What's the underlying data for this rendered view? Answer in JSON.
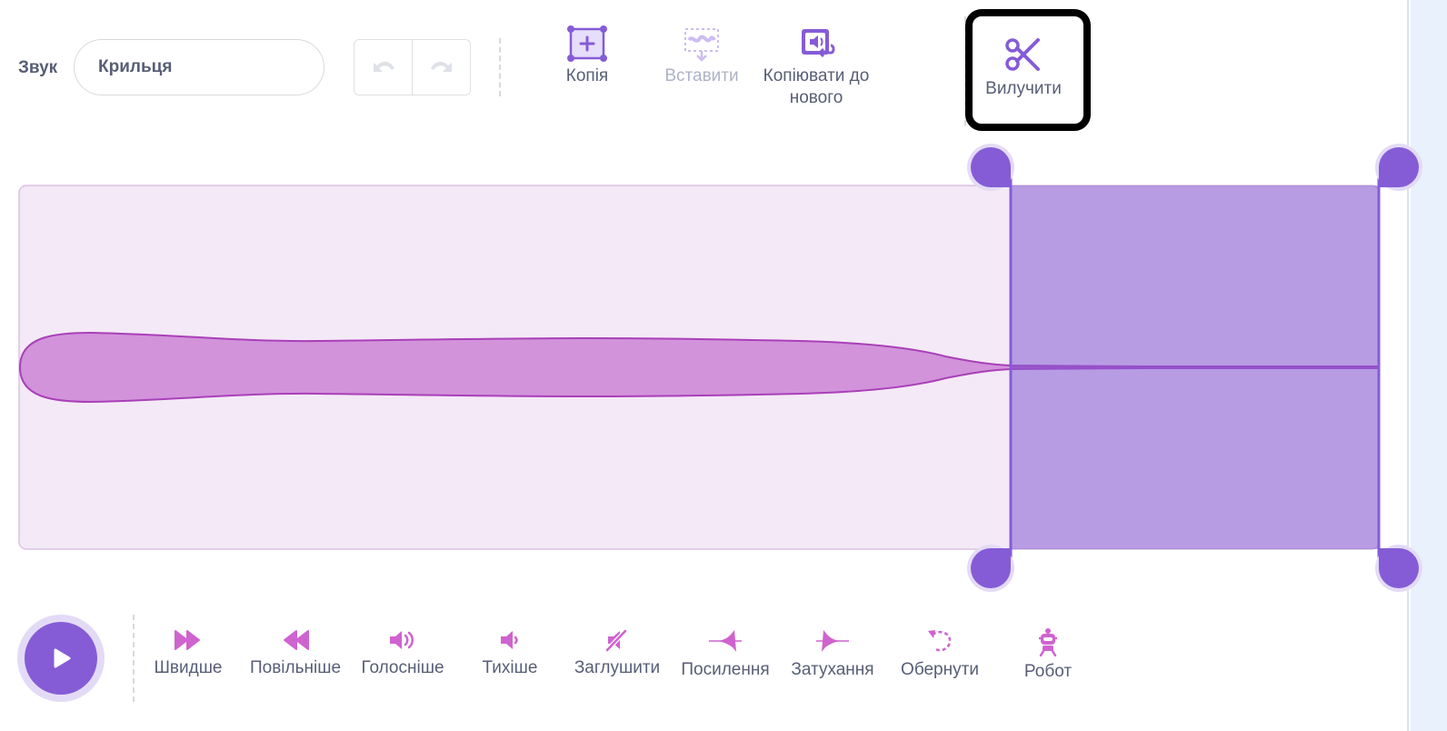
{
  "header": {
    "sound_label": "Звук",
    "sound_name": "Крильця"
  },
  "toolbar": {
    "copy_label": "Копія",
    "paste_label": "Вставити",
    "copy_to_new_label_line1": "Копіювати до",
    "copy_to_new_label_line2": "нового",
    "delete_label": "Вилучити"
  },
  "effects": [
    {
      "label": "Швидше",
      "icon": "faster-icon"
    },
    {
      "label": "Повільніше",
      "icon": "slower-icon"
    },
    {
      "label": "Голосніше",
      "icon": "louder-icon"
    },
    {
      "label": "Тихіше",
      "icon": "softer-icon"
    },
    {
      "label": "Заглушити",
      "icon": "mute-icon"
    },
    {
      "label": "Посилення",
      "icon": "fade-in-icon"
    },
    {
      "label": "Затухання",
      "icon": "fade-out-icon"
    },
    {
      "label": "Обернути",
      "icon": "reverse-icon"
    },
    {
      "label": "Робот",
      "icon": "robot-icon"
    }
  ],
  "colors": {
    "accent": "#855cd6",
    "waveform_fill": "#d293db",
    "waveform_bg": "#f4e9f6",
    "selection": "#b8a2e3",
    "effect_icon": "#cf63cf"
  }
}
